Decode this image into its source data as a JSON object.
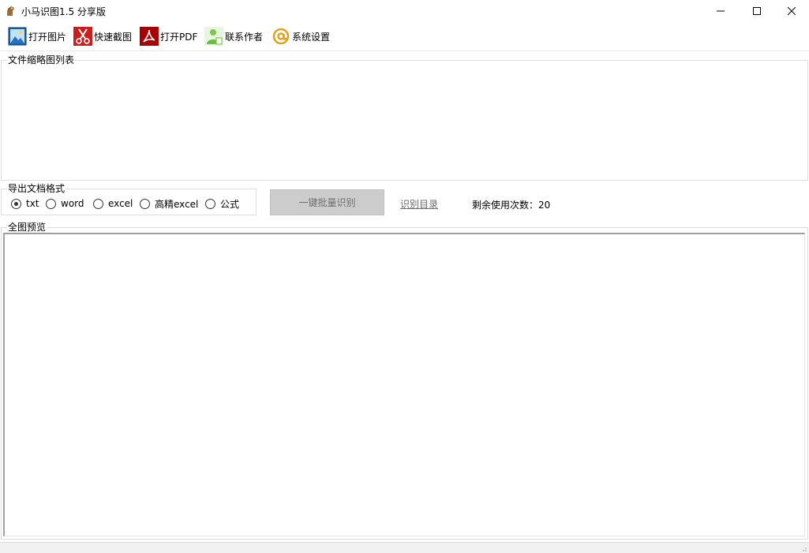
{
  "window": {
    "title": "小马识图1.5  分享版",
    "buttons": {
      "minimize": "minimize-icon",
      "maximize": "maximize-icon",
      "close": "close-icon"
    }
  },
  "toolbar": {
    "items": [
      {
        "label": "打开图片",
        "icon": "image-icon",
        "color": "#2a6fc2"
      },
      {
        "label": "快速截图",
        "icon": "scissors-icon",
        "color": "#d02020"
      },
      {
        "label": "打开PDF",
        "icon": "pdf-icon",
        "color": "#b00000"
      },
      {
        "label": "联系作者",
        "icon": "contact-icon",
        "color": "#6abf3a"
      },
      {
        "label": "系统设置",
        "icon": "at-icon",
        "color": "#e0a020"
      }
    ]
  },
  "thumbnails": {
    "legend": "文件缩略图列表"
  },
  "export_format": {
    "legend": "导出文档格式",
    "options": [
      {
        "label": "txt",
        "checked": true
      },
      {
        "label": "word",
        "checked": false
      },
      {
        "label": "excel",
        "checked": false
      },
      {
        "label": "高精excel",
        "checked": false
      },
      {
        "label": "公式",
        "checked": false
      }
    ]
  },
  "actions": {
    "batch_button": "一键批量识别",
    "dir_link": "识别目录",
    "remaining": "剩余使用次数：20"
  },
  "preview": {
    "legend": "全图预览"
  }
}
